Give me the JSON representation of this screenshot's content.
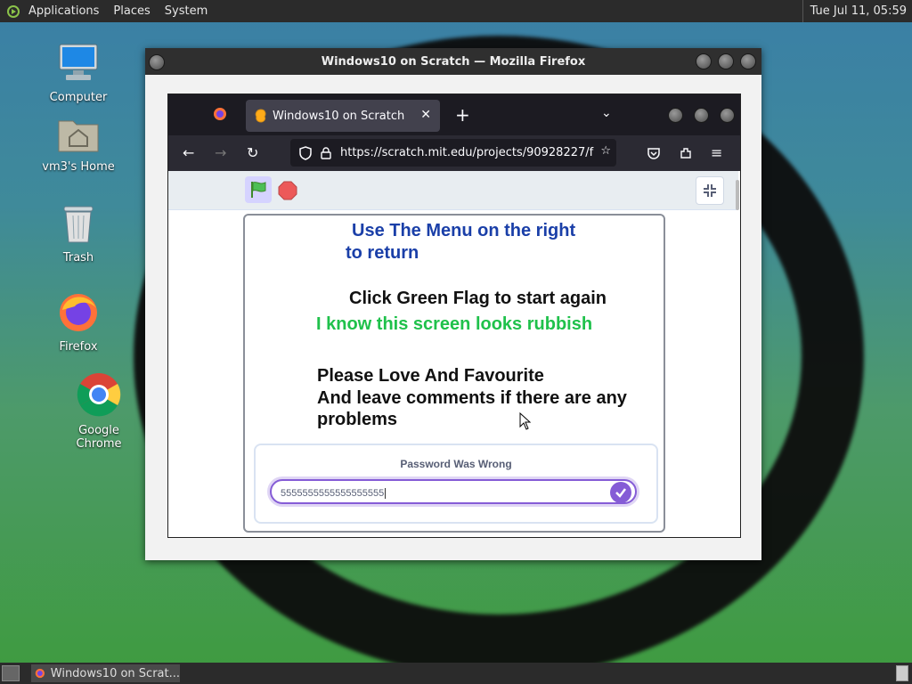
{
  "top_panel": {
    "menus": [
      "Applications",
      "Places",
      "System"
    ],
    "clock": "Tue Jul 11, 05:59"
  },
  "desktop_icons": [
    {
      "label": "Computer",
      "icon": "computer-icon"
    },
    {
      "label": "vm3's Home",
      "icon": "home-folder-icon"
    },
    {
      "label": "Trash",
      "icon": "trash-icon"
    },
    {
      "label": "Firefox",
      "icon": "firefox-icon"
    },
    {
      "label": "Google Chrome",
      "icon": "chrome-icon"
    }
  ],
  "outer_window": {
    "title": "Windows10 on Scratch — Mozilla Firefox"
  },
  "browser": {
    "tab_title": "Windows10 on Scratch",
    "url": "https://scratch.mit.edu/projects/90928227/f"
  },
  "stage": {
    "line1": "Use The Menu on the right",
    "line2": "to return",
    "line3": "Click Green Flag to start again",
    "line4": "I know this screen looks rubbish",
    "line5": "Please Love And Favourite",
    "line6": "And leave comments if there are any",
    "line7": "problems",
    "ask_question": "Password Was Wrong",
    "ask_value": "5555555555555555555"
  },
  "taskbar": {
    "item_label": "Windows10 on Scrat..."
  },
  "colors": {
    "stage_blue": "#1a3fa8",
    "stage_green": "#1fc14b",
    "scratch_purple": "#855cd6"
  }
}
